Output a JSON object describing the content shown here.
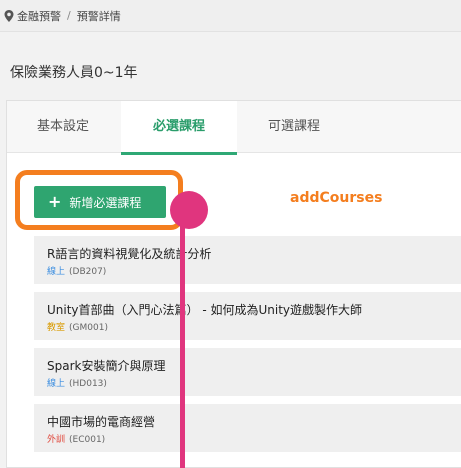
{
  "breadcrumb": {
    "icon": "location-pin-icon",
    "items": [
      "金融預警",
      "預警詳情"
    ],
    "separator": "/"
  },
  "page_title": "保險業務人員0~1年",
  "tabs": [
    {
      "label": "基本設定",
      "active": false
    },
    {
      "label": "必選課程",
      "active": true
    },
    {
      "label": "可選課程",
      "active": false
    }
  ],
  "add_button": {
    "label": "新增必選課程",
    "icon": "plus-icon"
  },
  "annotation": {
    "label": "addCourses",
    "color": "#f47e1f",
    "pointer_color": "#e0357e"
  },
  "colors": {
    "accent": "#2fa570",
    "online": "#3a8de0",
    "classroom": "#d99a00",
    "external": "#e0463a"
  },
  "courses": [
    {
      "name": "R語言的資料視覺化及統計分析",
      "type": "線上",
      "code": "(DB207)",
      "type_color": "#3a8de0"
    },
    {
      "name": "Unity首部曲（入門心法篇） - 如何成為Unity遊戲製作大師",
      "type": "教室",
      "code": "(GM001)",
      "type_color": "#d99a00"
    },
    {
      "name": "Spark安裝簡介與原理",
      "type": "線上",
      "code": "(HD013)",
      "type_color": "#3a8de0"
    },
    {
      "name": "中國市場的電商經營",
      "type": "外訓",
      "code": "(EC001)",
      "type_color": "#e0463a"
    }
  ]
}
